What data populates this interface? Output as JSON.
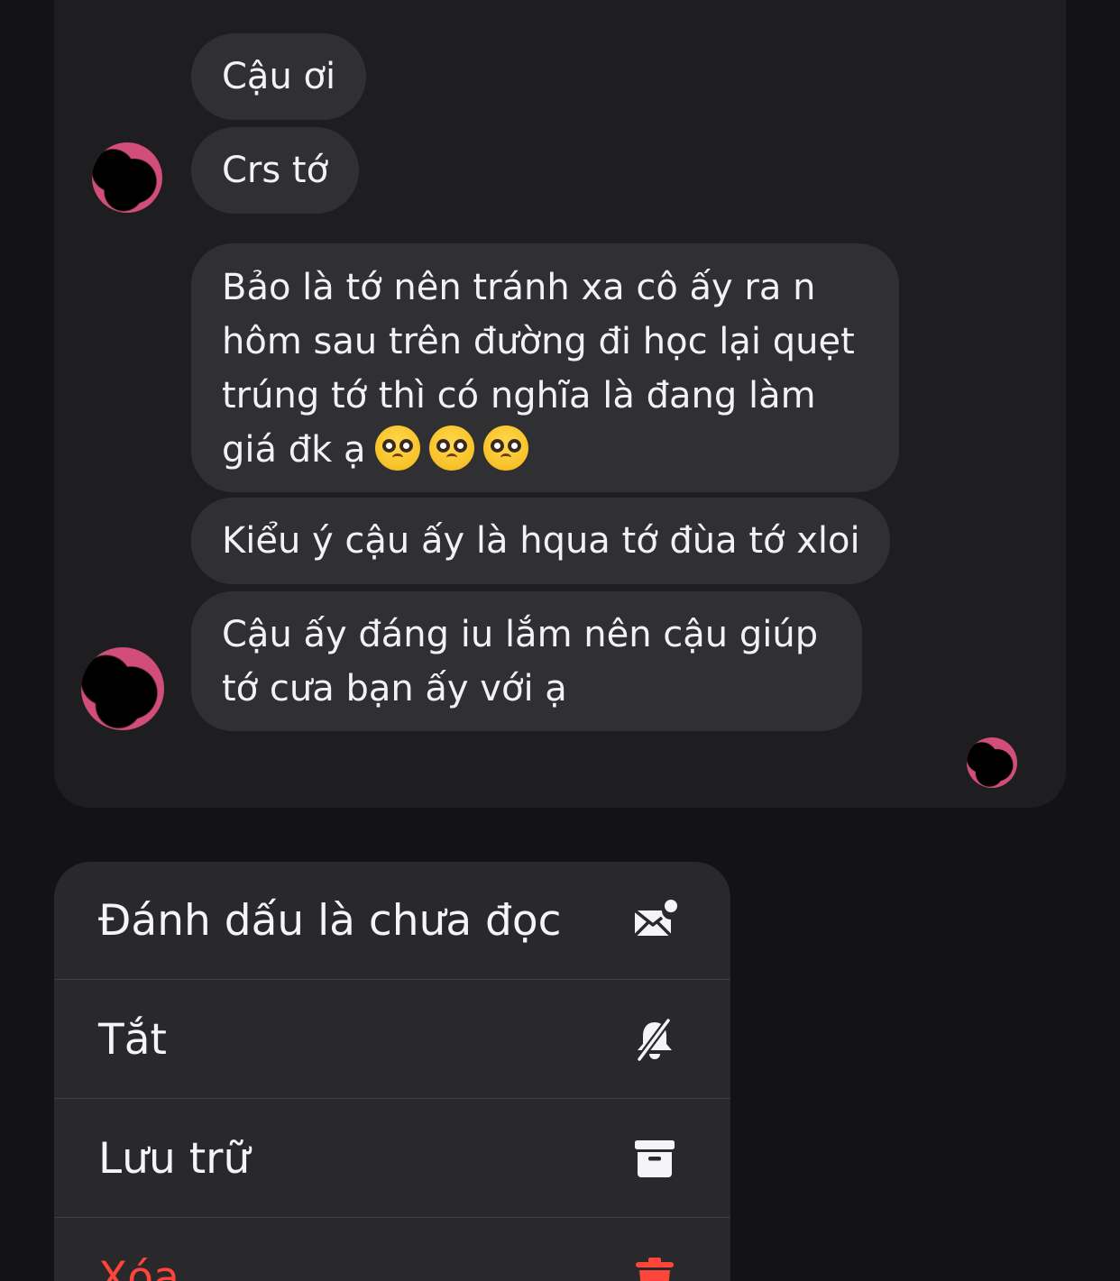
{
  "chat": {
    "messages": [
      {
        "lines": [
          "Cậu ơi"
        ]
      },
      {
        "lines": [
          "Crs tớ"
        ]
      },
      {
        "lines": [
          "Bảo là tớ nên tránh xa cô ấy ra n",
          "hôm sau trên đường đi học lại quẹt",
          "trúng tớ thì có nghĩa là đang làm",
          "giá đk ạ"
        ],
        "emoji": [
          "pleading-face-emoji",
          "pleading-face-emoji",
          "pleading-face-emoji"
        ]
      },
      {
        "lines": [
          "Kiểu ý cậu ấy là hqua tớ đùa tớ xloi"
        ]
      },
      {
        "lines": [
          "Cậu ấy đáng iu lắm nên cậu giúp",
          "tớ cưa bạn ấy với ạ"
        ]
      }
    ]
  },
  "menu": {
    "items": [
      {
        "label": "Đánh dấu là chưa đọc",
        "icon": "mail-unread-icon"
      },
      {
        "label": "Tắt",
        "icon": "bell-slash-icon"
      },
      {
        "label": "Lưu trữ",
        "icon": "archive-box-icon"
      },
      {
        "label": "Xóa",
        "icon": "trash-icon",
        "color": "#ff453a"
      }
    ]
  },
  "colors": {
    "background": "#131315",
    "chat_card": "#1e1e20",
    "bubble": "#303033",
    "menu": "#29292c",
    "danger": "#ff453a"
  }
}
